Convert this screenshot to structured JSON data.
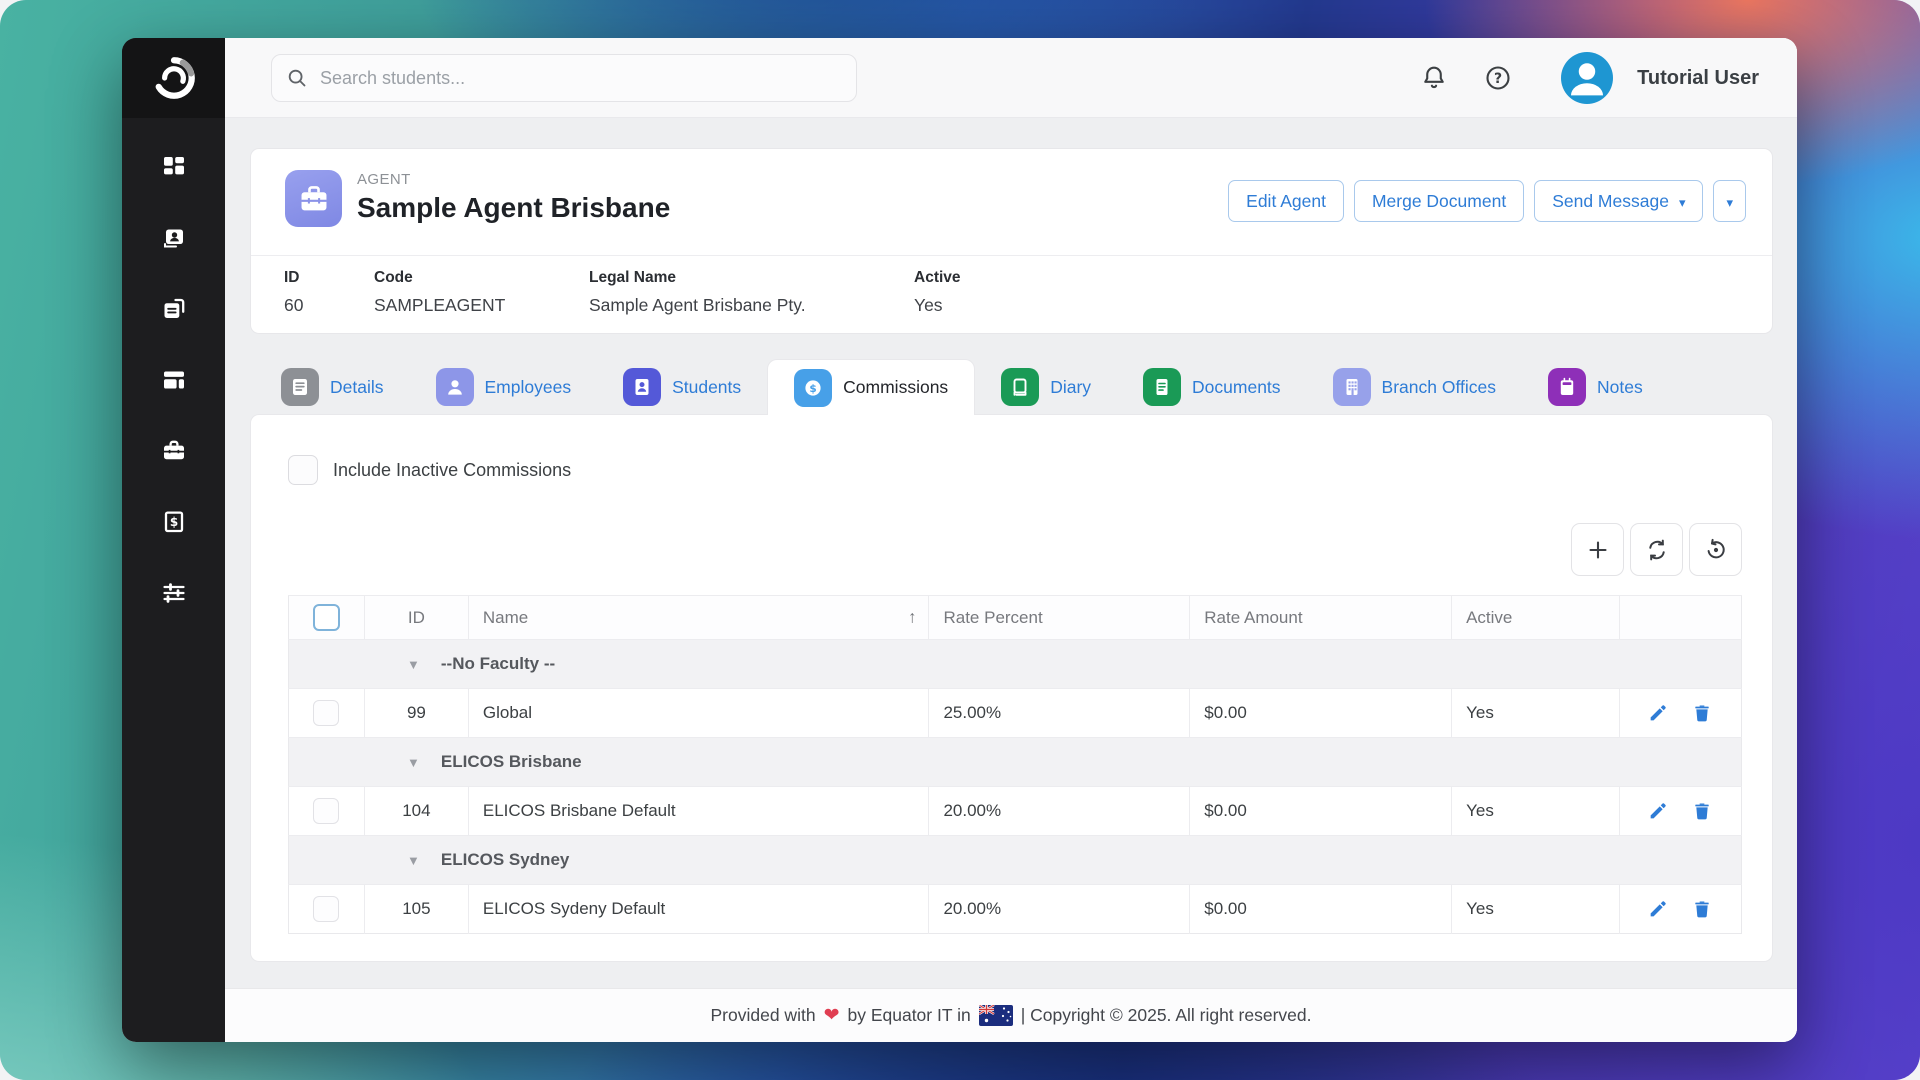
{
  "topbar": {
    "search_placeholder": "Search students...",
    "user_name": "Tutorial User"
  },
  "sidebar": {
    "items": [
      {
        "icon": "dashboard-icon"
      },
      {
        "icon": "contacts-icon"
      },
      {
        "icon": "documents-stack-icon"
      },
      {
        "icon": "layout-icon"
      },
      {
        "icon": "briefcase-icon"
      },
      {
        "icon": "invoice-icon"
      },
      {
        "icon": "sliders-icon"
      }
    ]
  },
  "agent": {
    "type_label": "AGENT",
    "name": "Sample Agent Brisbane",
    "actions": {
      "edit": "Edit Agent",
      "merge": "Merge Document",
      "send": "Send Message"
    },
    "info": {
      "id_label": "ID",
      "id_value": "60",
      "code_label": "Code",
      "code_value": "SAMPLEAGENT",
      "legal_label": "Legal Name",
      "legal_value": "Sample Agent Brisbane Pty.",
      "active_label": "Active",
      "active_value": "Yes"
    }
  },
  "tabs": [
    {
      "label": "Details",
      "color": "#8d9095",
      "active": false
    },
    {
      "label": "Employees",
      "color": "#8d96e8",
      "active": false
    },
    {
      "label": "Students",
      "color": "#5459d8",
      "active": false
    },
    {
      "label": "Commissions",
      "color": "#47a0e8",
      "active": true
    },
    {
      "label": "Diary",
      "color": "#1a9a56",
      "active": false
    },
    {
      "label": "Documents",
      "color": "#1a9a56",
      "active": false
    },
    {
      "label": "Branch Offices",
      "color": "#97a1ea",
      "active": false
    },
    {
      "label": "Notes",
      "color": "#8e2fb8",
      "active": false
    }
  ],
  "commissions": {
    "include_inactive_label": "Include Inactive Commissions",
    "columns": {
      "id": "ID",
      "name": "Name",
      "rate_percent": "Rate Percent",
      "rate_amount": "Rate Amount",
      "active": "Active"
    },
    "groups": [
      {
        "name": "--No Faculty --",
        "rows": [
          {
            "id": "99",
            "name": "Global",
            "rate_percent": "25.00%",
            "rate_amount": "$0.00",
            "active": "Yes"
          }
        ]
      },
      {
        "name": "ELICOS Brisbane",
        "rows": [
          {
            "id": "104",
            "name": "ELICOS Brisbane Default",
            "rate_percent": "20.00%",
            "rate_amount": "$0.00",
            "active": "Yes"
          }
        ]
      },
      {
        "name": "ELICOS Sydney",
        "rows": [
          {
            "id": "105",
            "name": "ELICOS Sydeny Default",
            "rate_percent": "20.00%",
            "rate_amount": "$0.00",
            "active": "Yes"
          }
        ]
      }
    ]
  },
  "footer": {
    "provided": "Provided with",
    "heart": "❤",
    "by": "by Equator IT in",
    "copyright": "| Copyright © 2025. All right reserved."
  },
  "colors": {
    "accent_blue": "#2e7cd6",
    "avatar_blue": "#1e96d2",
    "agent_icon_purple": "#8f97ea",
    "sidebar_bg": "#1d1d1f",
    "group_row_bg": "#f2f2f4"
  }
}
